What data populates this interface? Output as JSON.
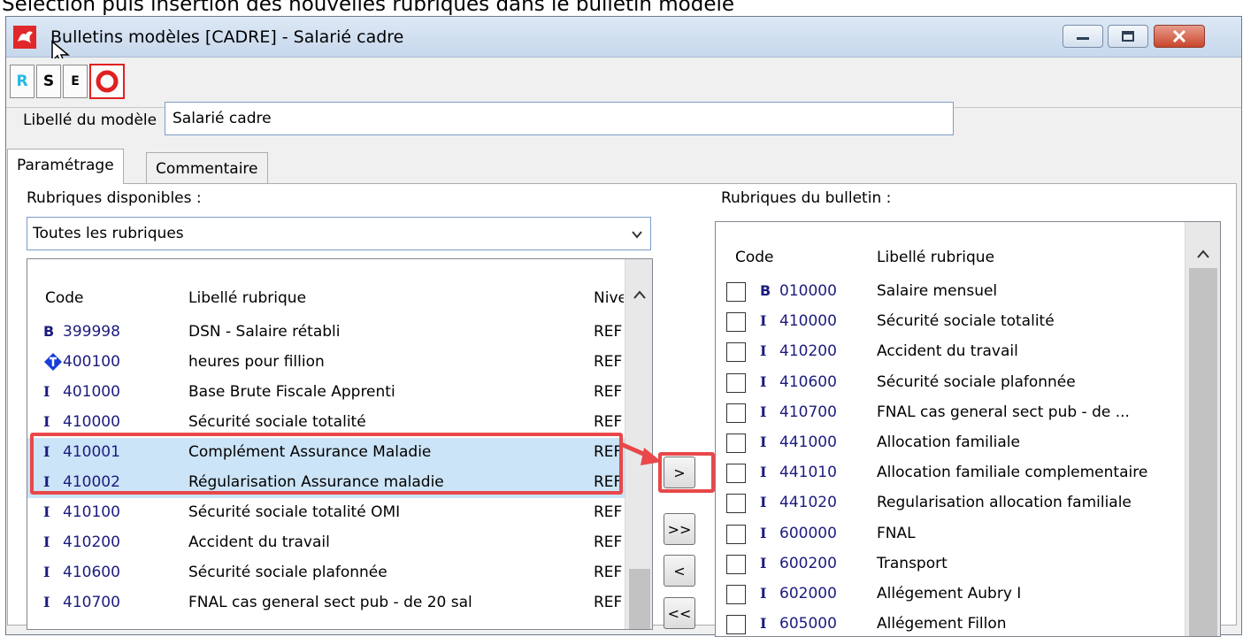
{
  "caption": "Sélection puis insertion des nouvelles rubriques dans le bulletin modèle",
  "window": {
    "title": "Bulletins modèles [CADRE] - Salarié cadre",
    "accent_close": "#c9462c"
  },
  "toolbar": {
    "r_label": "R",
    "s_label": "S",
    "e_label": "E"
  },
  "modele": {
    "label": "Libellé du modèle",
    "value": "Salarié cadre"
  },
  "tabs": [
    {
      "label": "Paramétrage"
    },
    {
      "label": "Commentaire"
    }
  ],
  "left": {
    "label": "Rubriques disponibles :",
    "filter": "Toutes les rubriques",
    "headers": {
      "code": "Code",
      "libelle": "Libellé rubrique",
      "niveau": "Niveau"
    },
    "rows": [
      {
        "icon": "B",
        "code": "399998",
        "libelle": "DSN - Salaire rétabli",
        "niveau": "REF"
      },
      {
        "icon": "T",
        "code": "400100",
        "libelle": "heures pour fillion",
        "niveau": "REF"
      },
      {
        "icon": "I",
        "code": "401000",
        "libelle": "Base Brute Fiscale Apprenti",
        "niveau": "REF"
      },
      {
        "icon": "I",
        "code": "410000",
        "libelle": "Sécurité sociale totalité",
        "niveau": "REF"
      },
      {
        "icon": "I",
        "code": "410001",
        "libelle": "Complément Assurance Maladie",
        "niveau": "REF"
      },
      {
        "icon": "I",
        "code": "410002",
        "libelle": "Régularisation Assurance maladie",
        "niveau": "REF"
      },
      {
        "icon": "I",
        "code": "410100",
        "libelle": "Sécurité sociale totalité OMI",
        "niveau": "REF"
      },
      {
        "icon": "I",
        "code": "410200",
        "libelle": "Accident du travail",
        "niveau": "REF"
      },
      {
        "icon": "I",
        "code": "410600",
        "libelle": "Sécurité sociale plafonnée",
        "niveau": "REF"
      },
      {
        "icon": "I",
        "code": "410700",
        "libelle": "FNAL cas general sect pub - de 20 sal",
        "niveau": "REF"
      }
    ]
  },
  "move_buttons": {
    "add": ">",
    "add_all": ">>",
    "remove": "<",
    "remove_all": "<<"
  },
  "right": {
    "label": "Rubriques du bulletin :",
    "headers": {
      "code": "Code",
      "libelle": "Libellé rubrique"
    },
    "rows": [
      {
        "icon": "B",
        "code": "010000",
        "libelle": "Salaire mensuel"
      },
      {
        "icon": "I",
        "code": "410000",
        "libelle": "Sécurité sociale totalité"
      },
      {
        "icon": "I",
        "code": "410200",
        "libelle": "Accident du travail"
      },
      {
        "icon": "I",
        "code": "410600",
        "libelle": "Sécurité sociale plafonnée"
      },
      {
        "icon": "I",
        "code": "410700",
        "libelle": "FNAL cas general sect pub - de ..."
      },
      {
        "icon": "I",
        "code": "441000",
        "libelle": "Allocation familiale"
      },
      {
        "icon": "I",
        "code": "441010",
        "libelle": "Allocation familiale complementaire"
      },
      {
        "icon": "I",
        "code": "441020",
        "libelle": "Regularisation allocation familiale"
      },
      {
        "icon": "I",
        "code": "600000",
        "libelle": "FNAL"
      },
      {
        "icon": "I",
        "code": "600200",
        "libelle": "Transport"
      },
      {
        "icon": "I",
        "code": "602000",
        "libelle": "Allégement Aubry I"
      },
      {
        "icon": "I",
        "code": "605000",
        "libelle": "Allégement Fillon"
      }
    ]
  },
  "highlight_color": "#e8484a"
}
